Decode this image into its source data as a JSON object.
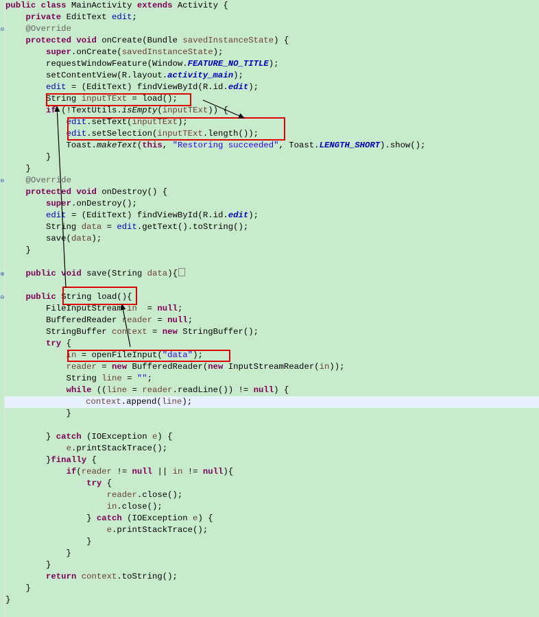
{
  "editor": {
    "highlight_color": "#e8f2fe",
    "background_color": "#c7ebcc",
    "annotation_color": "#e00000",
    "lines": [
      [
        [
          "kw",
          "public class "
        ],
        [
          "",
          "MainActivity "
        ],
        [
          "kw",
          "extends "
        ],
        [
          "",
          "Activity {"
        ]
      ],
      [
        [
          "",
          "    "
        ],
        [
          "kw",
          "private "
        ],
        [
          "",
          "EditText "
        ],
        [
          "fld",
          "edit"
        ],
        [
          "",
          ";"
        ]
      ],
      [
        [
          "",
          "    "
        ],
        [
          "ann",
          "@Override"
        ]
      ],
      [
        [
          "",
          "    "
        ],
        [
          "kw",
          "protected void "
        ],
        [
          "",
          "onCreate(Bundle "
        ],
        [
          "var",
          "savedInstanceState"
        ],
        [
          "",
          ") {"
        ]
      ],
      [
        [
          "",
          "        "
        ],
        [
          "kw",
          "super"
        ],
        [
          "",
          ".onCreate("
        ],
        [
          "var",
          "savedInstanceState"
        ],
        [
          "",
          ");"
        ]
      ],
      [
        [
          "",
          "        requestWindowFeature(Window."
        ],
        [
          "sfld",
          "FEATURE_NO_TITLE"
        ],
        [
          "",
          ");"
        ]
      ],
      [
        [
          "",
          "        setContentView(R.layout."
        ],
        [
          "sfld",
          "activity_main"
        ],
        [
          "",
          ");"
        ]
      ],
      [
        [
          "",
          "        "
        ],
        [
          "fld",
          "edit"
        ],
        [
          "",
          " = (EditText) findViewById(R.id."
        ],
        [
          "sfld",
          "edit"
        ],
        [
          "",
          ");"
        ]
      ],
      [
        [
          "",
          "        String "
        ],
        [
          "var",
          "inputTExt"
        ],
        [
          "",
          " = load();"
        ]
      ],
      [
        [
          "",
          "        "
        ],
        [
          "kw",
          "if "
        ],
        [
          "",
          "(!TextUtils."
        ],
        [
          "ital",
          "isEmpty"
        ],
        [
          "",
          "("
        ],
        [
          "var",
          "inputTExt"
        ],
        [
          "",
          ")) {"
        ]
      ],
      [
        [
          "",
          "            "
        ],
        [
          "fld",
          "edit"
        ],
        [
          "",
          ".setText("
        ],
        [
          "var",
          "inputTExt"
        ],
        [
          "",
          ");"
        ]
      ],
      [
        [
          "",
          "            "
        ],
        [
          "fld",
          "edit"
        ],
        [
          "",
          ".setSelection("
        ],
        [
          "var",
          "inputTExt"
        ],
        [
          "",
          ".length());"
        ]
      ],
      [
        [
          "",
          "            Toast."
        ],
        [
          "ital",
          "makeText"
        ],
        [
          "",
          "("
        ],
        [
          "kw",
          "this"
        ],
        [
          "",
          ", "
        ],
        [
          "str",
          "\"Restoring succeeded\""
        ],
        [
          "",
          ", Toast."
        ],
        [
          "sfld",
          "LENGTH_SHORT"
        ],
        [
          "",
          ").show();"
        ]
      ],
      [
        [
          "",
          "        }"
        ]
      ],
      [
        [
          "",
          "    }"
        ]
      ],
      [
        [
          "",
          "    "
        ],
        [
          "ann",
          "@Override"
        ]
      ],
      [
        [
          "",
          "    "
        ],
        [
          "kw",
          "protected void "
        ],
        [
          "",
          "onDestroy() {"
        ]
      ],
      [
        [
          "",
          "        "
        ],
        [
          "kw",
          "super"
        ],
        [
          "",
          ".onDestroy();"
        ]
      ],
      [
        [
          "",
          "        "
        ],
        [
          "fld",
          "edit"
        ],
        [
          "",
          " = (EditText) findViewById(R.id."
        ],
        [
          "sfld",
          "edit"
        ],
        [
          "",
          ");"
        ]
      ],
      [
        [
          "",
          "        String "
        ],
        [
          "var",
          "data"
        ],
        [
          "",
          " = "
        ],
        [
          "fld",
          "edit"
        ],
        [
          "",
          ".getText().toString();"
        ]
      ],
      [
        [
          "",
          "        save("
        ],
        [
          "var",
          "data"
        ],
        [
          "",
          ");"
        ]
      ],
      [
        [
          "",
          "    }"
        ]
      ],
      [
        [
          "",
          ""
        ]
      ],
      [
        [
          "",
          "    "
        ],
        [
          "kw",
          "public void "
        ],
        [
          "",
          "save(String "
        ],
        [
          "var",
          "data"
        ],
        [
          "",
          "){"
        ]
      ],
      [
        [
          "",
          ""
        ]
      ],
      [
        [
          "",
          "    "
        ],
        [
          "kw",
          "public "
        ],
        [
          "",
          "String load(){"
        ]
      ],
      [
        [
          "",
          "        FileInputStream "
        ],
        [
          "var",
          "in"
        ],
        [
          "",
          "  = "
        ],
        [
          "kw",
          "null"
        ],
        [
          "",
          ";"
        ]
      ],
      [
        [
          "",
          "        BufferedReader "
        ],
        [
          "var",
          "reader"
        ],
        [
          "",
          " = "
        ],
        [
          "kw",
          "null"
        ],
        [
          "",
          ";"
        ]
      ],
      [
        [
          "",
          "        StringBuffer "
        ],
        [
          "var",
          "context"
        ],
        [
          "",
          " = "
        ],
        [
          "kw",
          "new "
        ],
        [
          "",
          "StringBuffer();"
        ]
      ],
      [
        [
          "",
          "        "
        ],
        [
          "kw",
          "try "
        ],
        [
          "",
          "{"
        ]
      ],
      [
        [
          "",
          "            "
        ],
        [
          "var",
          "in"
        ],
        [
          "",
          " = openFileInput("
        ],
        [
          "str",
          "\"data\""
        ],
        [
          "",
          ");"
        ]
      ],
      [
        [
          "",
          "            "
        ],
        [
          "var",
          "reader"
        ],
        [
          "",
          " = "
        ],
        [
          "kw",
          "new "
        ],
        [
          "",
          "BufferedReader("
        ],
        [
          "kw",
          "new "
        ],
        [
          "",
          "InputStreamReader("
        ],
        [
          "var",
          "in"
        ],
        [
          "",
          "));"
        ]
      ],
      [
        [
          "",
          "            String "
        ],
        [
          "var",
          "line"
        ],
        [
          "",
          " = "
        ],
        [
          "str",
          "\"\""
        ],
        [
          "",
          ";"
        ]
      ],
      [
        [
          "",
          "            "
        ],
        [
          "kw",
          "while "
        ],
        [
          "",
          "(("
        ],
        [
          "var",
          "line"
        ],
        [
          "",
          " = "
        ],
        [
          "var",
          "reader"
        ],
        [
          "",
          ".readLine()) != "
        ],
        [
          "kw",
          "null"
        ],
        [
          "",
          ") {"
        ]
      ],
      [
        [
          "",
          "                "
        ],
        [
          "var",
          "context"
        ],
        [
          "",
          ".append("
        ],
        [
          "var",
          "line"
        ],
        [
          "",
          ");"
        ]
      ],
      [
        [
          "",
          "            }"
        ]
      ],
      [
        [
          "",
          ""
        ]
      ],
      [
        [
          "",
          "        } "
        ],
        [
          "kw",
          "catch "
        ],
        [
          "",
          "(IOException "
        ],
        [
          "var",
          "e"
        ],
        [
          "",
          ") {"
        ]
      ],
      [
        [
          "",
          "            "
        ],
        [
          "var",
          "e"
        ],
        [
          "",
          ".printStackTrace();"
        ]
      ],
      [
        [
          "",
          "        }"
        ],
        [
          "kw",
          "finally "
        ],
        [
          "",
          "{"
        ]
      ],
      [
        [
          "",
          "            "
        ],
        [
          "kw",
          "if"
        ],
        [
          "",
          "("
        ],
        [
          "var",
          "reader"
        ],
        [
          "",
          " != "
        ],
        [
          "kw",
          "null"
        ],
        [
          "",
          " || "
        ],
        [
          "var",
          "in"
        ],
        [
          "",
          " != "
        ],
        [
          "kw",
          "null"
        ],
        [
          "",
          "){"
        ]
      ],
      [
        [
          "",
          "                "
        ],
        [
          "kw",
          "try "
        ],
        [
          "",
          "{"
        ]
      ],
      [
        [
          "",
          "                    "
        ],
        [
          "var",
          "reader"
        ],
        [
          "",
          ".close();"
        ]
      ],
      [
        [
          "",
          "                    "
        ],
        [
          "var",
          "in"
        ],
        [
          "",
          ".close();"
        ]
      ],
      [
        [
          "",
          "                } "
        ],
        [
          "kw",
          "catch "
        ],
        [
          "",
          "(IOException "
        ],
        [
          "var",
          "e"
        ],
        [
          "",
          ") {"
        ]
      ],
      [
        [
          "",
          "                    "
        ],
        [
          "var",
          "e"
        ],
        [
          "",
          ".printStackTrace();"
        ]
      ],
      [
        [
          "",
          "                }"
        ]
      ],
      [
        [
          "",
          "            }"
        ]
      ],
      [
        [
          "",
          "        }"
        ]
      ],
      [
        [
          "",
          "        "
        ],
        [
          "kw",
          "return "
        ],
        [
          "var",
          "context"
        ],
        [
          "",
          ".toString();"
        ]
      ],
      [
        [
          "",
          "    }"
        ]
      ],
      [
        [
          "",
          "}"
        ]
      ]
    ],
    "highlighted_line": 34,
    "folded_line": 23,
    "fold_markers": [
      {
        "line": 2,
        "icon": "collapse-icon"
      },
      {
        "line": 15,
        "icon": "collapse-icon"
      },
      {
        "line": 23,
        "icon": "expand-icon"
      },
      {
        "line": 25,
        "icon": "collapse-icon"
      }
    ]
  }
}
